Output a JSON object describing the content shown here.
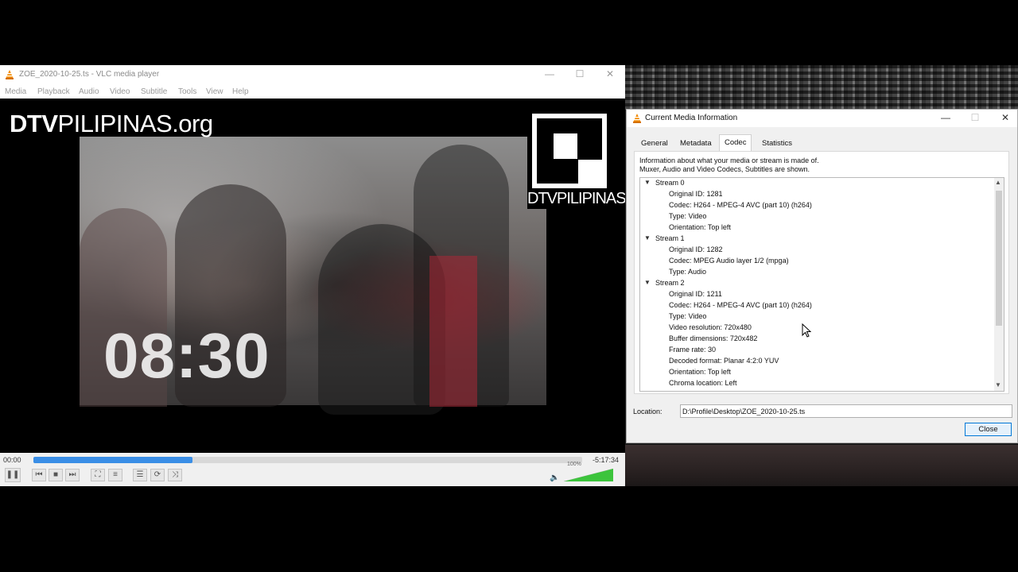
{
  "vlc": {
    "title": "ZOE_2020-10-25.ts - VLC media player",
    "menu": [
      "Media",
      "Playback",
      "Audio",
      "Video",
      "Subtitle",
      "Tools",
      "View",
      "Help"
    ],
    "window_buttons": {
      "minimize": "—",
      "maximize": "☐",
      "close": "✕"
    },
    "video": {
      "logo_bold": "DTV",
      "logo_rest": "PILIPINAS.org",
      "clock": "08:30",
      "corner_logo_text": "DTVPILIPINAS"
    },
    "controls": {
      "elapsed": "00:00",
      "remaining": "-5:17:34",
      "seek_progress": 0.29,
      "volume_label": "100%",
      "volume_level": 1.0,
      "buttons": {
        "pause": "❚❚",
        "prev": "⏮",
        "stop": "■",
        "next": "⏭",
        "fullscreen": "⛶",
        "extended": "≡",
        "playlist": "☰",
        "loop": "⟳",
        "shuffle": "⤨"
      }
    }
  },
  "info_dialog": {
    "title": "Current Media Information",
    "window_buttons": {
      "minimize": "—",
      "maximize": "☐",
      "close": "✕"
    },
    "tabs": [
      "General",
      "Metadata",
      "Codec",
      "Statistics"
    ],
    "active_tab": "Codec",
    "description_line1": "Information about what your media or stream is made of.",
    "description_line2": "Muxer, Audio and Video Codecs, Subtitles are shown.",
    "streams": [
      {
        "name": "Stream 0",
        "props": [
          "Original ID: 1281",
          "Codec: H264 - MPEG-4 AVC (part 10) (h264)",
          "Type: Video",
          "Orientation: Top left"
        ]
      },
      {
        "name": "Stream 1",
        "props": [
          "Original ID: 1282",
          "Codec: MPEG Audio layer 1/2 (mpga)",
          "Type: Audio"
        ]
      },
      {
        "name": "Stream 2",
        "props": [
          "Original ID: 1211",
          "Codec: H264 - MPEG-4 AVC (part 10) (h264)",
          "Type: Video",
          "Video resolution: 720x480",
          "Buffer dimensions: 720x482",
          "Frame rate: 30",
          "Decoded format: Planar 4:2:0 YUV",
          "Orientation: Top left",
          "Chroma location: Left"
        ]
      }
    ],
    "location_label": "Location:",
    "location_value": "D:\\Profile\\Desktop\\ZOE_2020-10-25.ts",
    "close_label": "Close"
  }
}
